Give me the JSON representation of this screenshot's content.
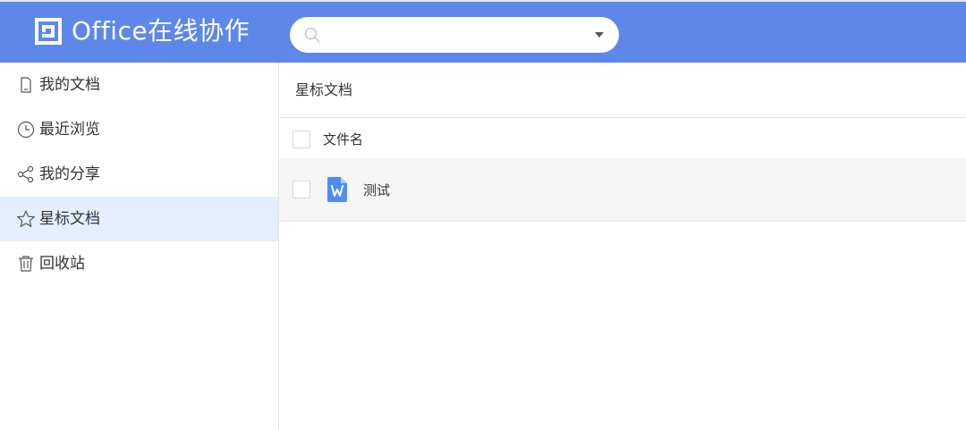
{
  "app": {
    "title": "Office在线协作",
    "logo_icon": "office-logo-icon"
  },
  "colors": {
    "header_bg": "#5d88ea",
    "active_nav_bg": "#e3eeff",
    "row_bg": "#f5f5f5",
    "word_icon": "#4c8ef5"
  },
  "search": {
    "value": "",
    "placeholder": "",
    "icon": "search-icon",
    "dropdown_icon": "caret-down-icon"
  },
  "sidebar": {
    "items": [
      {
        "label": "我的文档",
        "icon": "document-icon",
        "active": false
      },
      {
        "label": "最近浏览",
        "icon": "clock-icon",
        "active": false
      },
      {
        "label": "我的分享",
        "icon": "share-icon",
        "active": false
      },
      {
        "label": "星标文档",
        "icon": "star-icon",
        "active": true
      },
      {
        "label": "回收站",
        "icon": "trash-icon",
        "active": false
      }
    ]
  },
  "main": {
    "title": "星标文档",
    "columns": [
      {
        "label": "文件名"
      }
    ],
    "files": [
      {
        "name": "测试",
        "icon": "word-file-icon",
        "checked": false
      }
    ]
  }
}
